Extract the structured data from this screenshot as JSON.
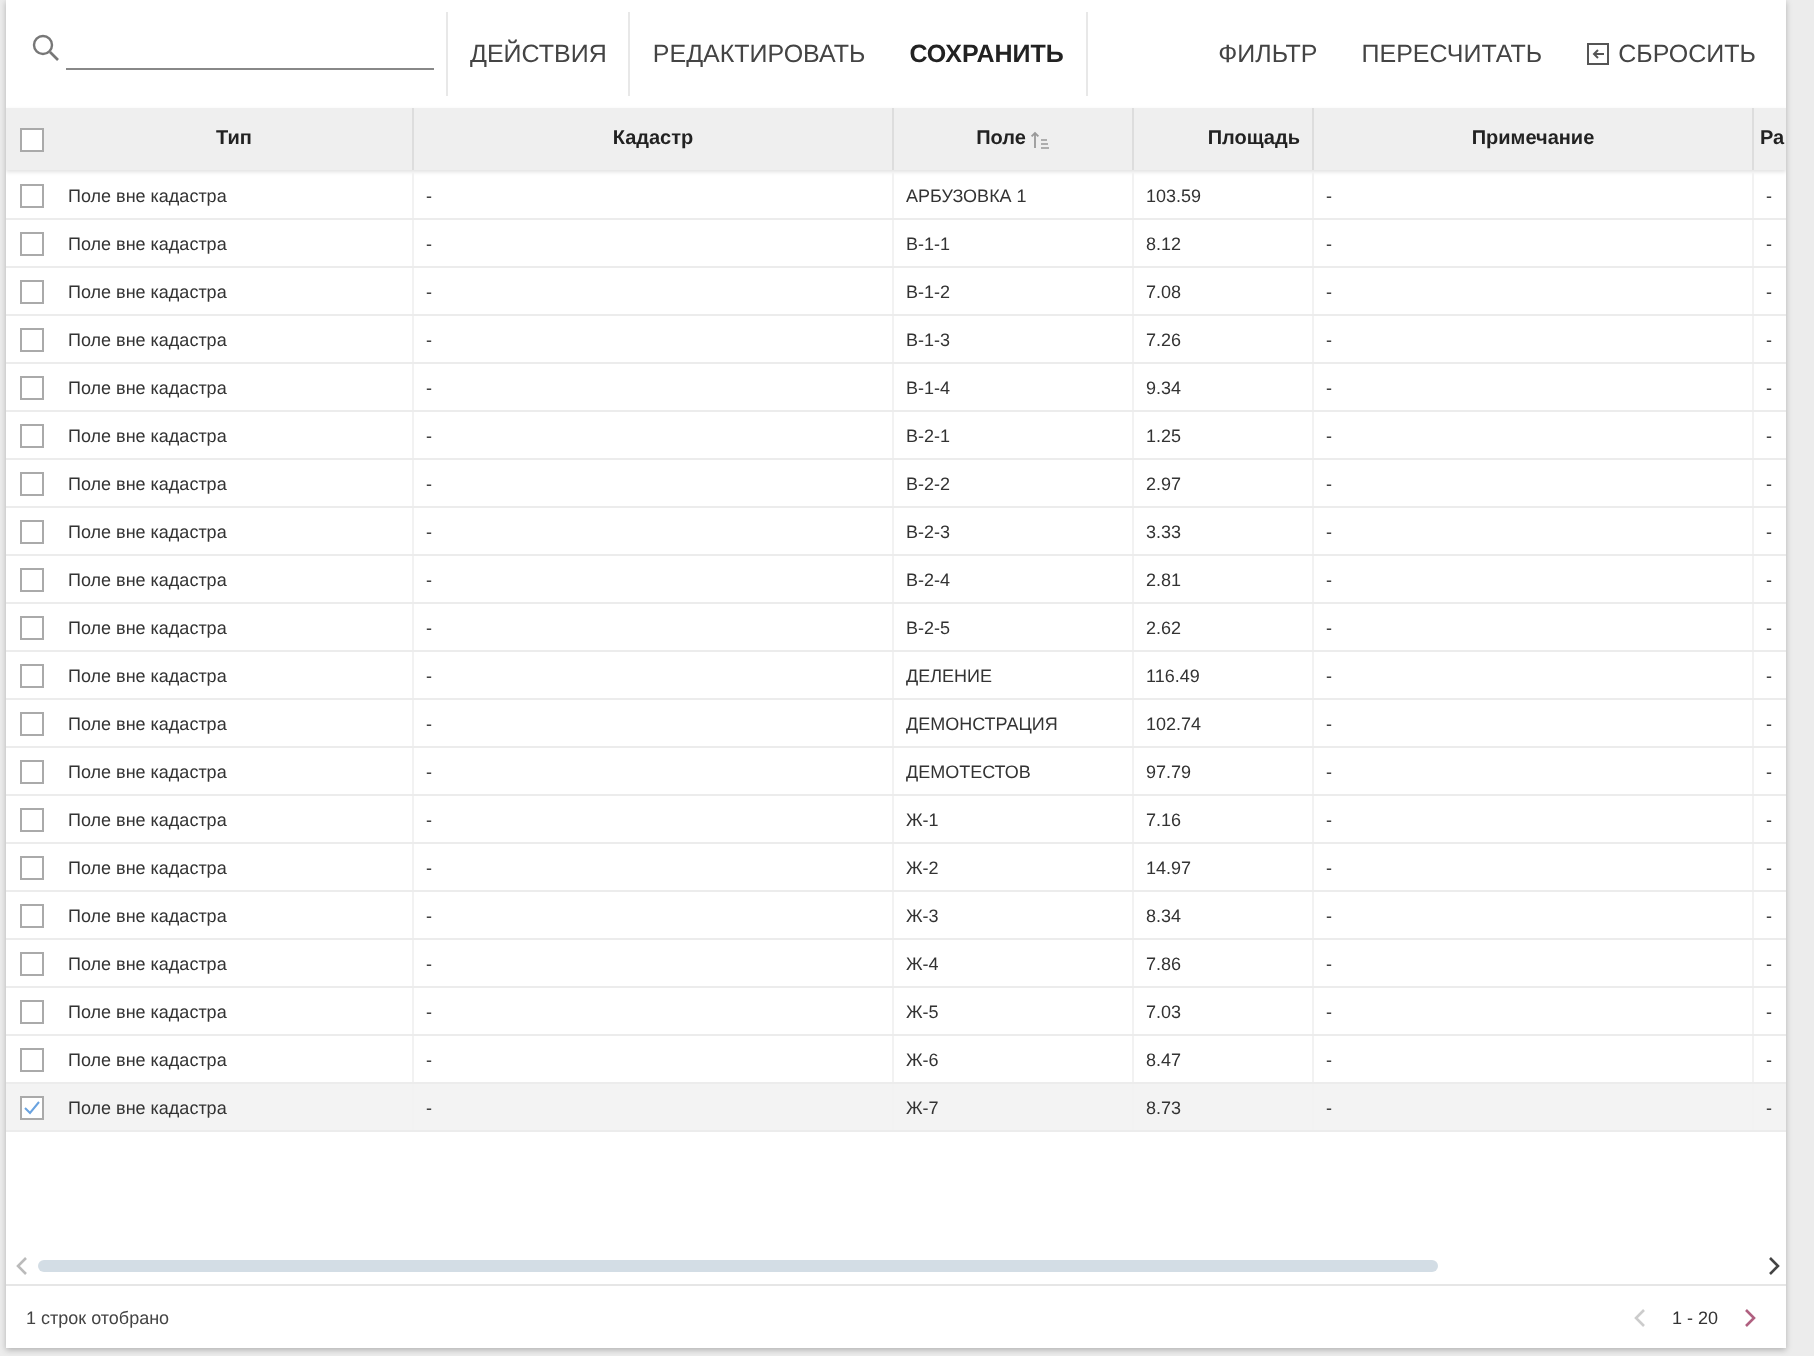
{
  "toolbar": {
    "left_actions": [
      {
        "label": "ДЕЙСТВИЯ",
        "emphasized": false
      },
      {
        "label": "РЕДАКТИРОВАТЬ",
        "emphasized": false
      },
      {
        "label": "СОХРАНИТЬ",
        "emphasized": true
      }
    ],
    "right_actions": [
      {
        "label": "ФИЛЬТР",
        "kind": "text"
      },
      {
        "label": "ПЕРЕСЧИТАТЬ",
        "kind": "text"
      },
      {
        "label": "СБРОСИТЬ",
        "kind": "icon"
      }
    ]
  },
  "table": {
    "select_all": {
      "checked": false
    },
    "columns": [
      {
        "label": "Тип"
      },
      {
        "label": "Кадастр"
      },
      {
        "label": "Поле",
        "sorted": true
      },
      {
        "label": "Площадь"
      },
      {
        "label": "Примечание"
      },
      {
        "label": "Ра"
      }
    ],
    "rows": [
      {
        "cells": [
          "Поле вне кадастра",
          "-",
          "АРБУЗОВКА 1",
          "103.59",
          "-",
          "-"
        ],
        "selected": false
      },
      {
        "cells": [
          "Поле вне кадастра",
          "-",
          "В-1-1",
          "8.12",
          "-",
          "-"
        ],
        "selected": false
      },
      {
        "cells": [
          "Поле вне кадастра",
          "-",
          "В-1-2",
          "7.08",
          "-",
          "-"
        ],
        "selected": false
      },
      {
        "cells": [
          "Поле вне кадастра",
          "-",
          "В-1-3",
          "7.26",
          "-",
          "-"
        ],
        "selected": false
      },
      {
        "cells": [
          "Поле вне кадастра",
          "-",
          "В-1-4",
          "9.34",
          "-",
          "-"
        ],
        "selected": false
      },
      {
        "cells": [
          "Поле вне кадастра",
          "-",
          "В-2-1",
          "1.25",
          "-",
          "-"
        ],
        "selected": false
      },
      {
        "cells": [
          "Поле вне кадастра",
          "-",
          "В-2-2",
          "2.97",
          "-",
          "-"
        ],
        "selected": false
      },
      {
        "cells": [
          "Поле вне кадастра",
          "-",
          "В-2-3",
          "3.33",
          "-",
          "-"
        ],
        "selected": false
      },
      {
        "cells": [
          "Поле вне кадастра",
          "-",
          "В-2-4",
          "2.81",
          "-",
          "-"
        ],
        "selected": false
      },
      {
        "cells": [
          "Поле вне кадастра",
          "-",
          "В-2-5",
          "2.62",
          "-",
          "-"
        ],
        "selected": false
      },
      {
        "cells": [
          "Поле вне кадастра",
          "-",
          "ДЕЛЕНИЕ",
          "116.49",
          "-",
          "-"
        ],
        "selected": false
      },
      {
        "cells": [
          "Поле вне кадастра",
          "-",
          "ДЕМОНСТРАЦИЯ",
          "102.74",
          "-",
          "-"
        ],
        "selected": false
      },
      {
        "cells": [
          "Поле вне кадастра",
          "-",
          "ДЕМОТЕСТОВ",
          "97.79",
          "-",
          "-"
        ],
        "selected": false
      },
      {
        "cells": [
          "Поле вне кадастра",
          "-",
          "Ж-1",
          "7.16",
          "-",
          "-"
        ],
        "selected": false
      },
      {
        "cells": [
          "Поле вне кадастра",
          "-",
          "Ж-2",
          "14.97",
          "-",
          "-"
        ],
        "selected": false
      },
      {
        "cells": [
          "Поле вне кадастра",
          "-",
          "Ж-3",
          "8.34",
          "-",
          "-"
        ],
        "selected": false
      },
      {
        "cells": [
          "Поле вне кадастра",
          "-",
          "Ж-4",
          "7.86",
          "-",
          "-"
        ],
        "selected": false
      },
      {
        "cells": [
          "Поле вне кадастра",
          "-",
          "Ж-5",
          "7.03",
          "-",
          "-"
        ],
        "selected": false
      },
      {
        "cells": [
          "Поле вне кадастра",
          "-",
          "Ж-6",
          "8.47",
          "-",
          "-"
        ],
        "selected": false
      },
      {
        "cells": [
          "Поле вне кадастра",
          "-",
          "Ж-7",
          "8.73",
          "-",
          "-"
        ],
        "selected": true
      }
    ]
  },
  "footer": {
    "selection_info": "1 строк отобрано",
    "pagination": {
      "range": "1 - 20",
      "previous_disabled": true,
      "next_disabled": false
    }
  }
}
